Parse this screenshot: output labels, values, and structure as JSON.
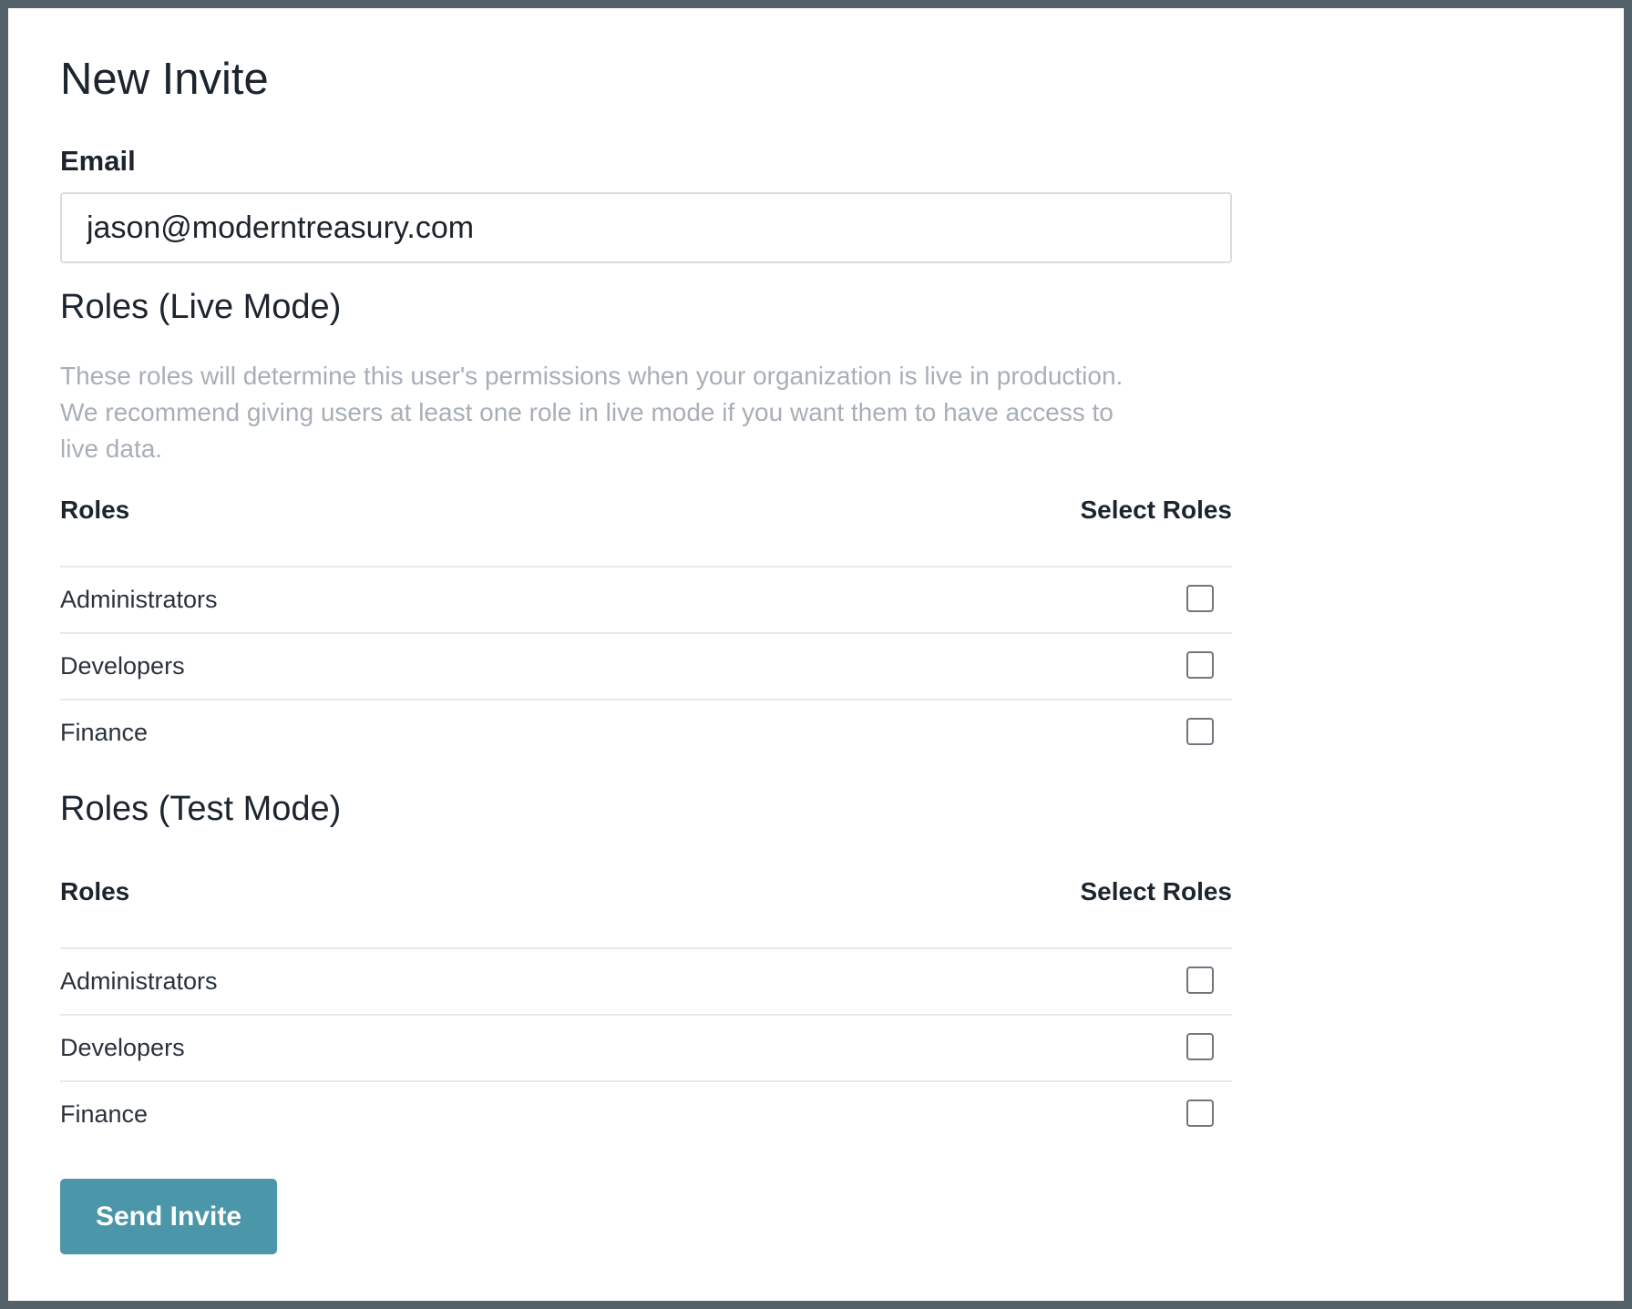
{
  "page": {
    "title": "New Invite"
  },
  "email": {
    "label": "Email",
    "value": "jason@moderntreasury.com"
  },
  "live_mode": {
    "title": "Roles (Live Mode)",
    "description": "These roles will determine this user's permissions when your organization is live in production.\nWe recommend giving users at least one role in live mode if you want them to have access to\nlive data.",
    "header_left": "Roles",
    "header_right": "Select Roles",
    "roles": [
      {
        "label": "Administrators",
        "checked": false
      },
      {
        "label": "Developers",
        "checked": false
      },
      {
        "label": "Finance",
        "checked": false
      }
    ]
  },
  "test_mode": {
    "title": "Roles (Test Mode)",
    "header_left": "Roles",
    "header_right": "Select Roles",
    "roles": [
      {
        "label": "Administrators",
        "checked": false
      },
      {
        "label": "Developers",
        "checked": false
      },
      {
        "label": "Finance",
        "checked": false
      }
    ]
  },
  "actions": {
    "send_label": "Send Invite"
  },
  "colors": {
    "accent": "#4b96a8",
    "frame": "#556169",
    "muted_text": "#a8afb7"
  }
}
